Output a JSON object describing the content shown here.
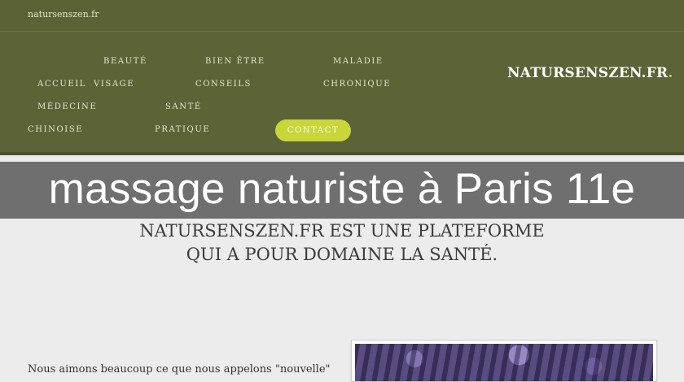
{
  "topbar": {
    "site_name": "natursenszen.fr"
  },
  "nav": {
    "accueil": "ACCUEIL",
    "beaute": "BEAUTÉ",
    "visage": "VISAGE",
    "bien_etre": "BIEN ÊTRE",
    "conseils": "CONSEILS",
    "maladie": "MALADIE",
    "chronique": "CHRONIQUE",
    "medecine": "MÉDECINE",
    "chinoise": "CHINOISE",
    "sante": "SANTÉ",
    "pratique": "PRATIQUE",
    "contact": "CONTACT"
  },
  "brand": {
    "name": "NATURSENSZEN.FR",
    "dot": "."
  },
  "page_title": "massage naturiste à Paris 11e",
  "tagline": "NATURSENSZEN.FR EST UNE PLATEFORME QUI A POUR DOMAINE LA SANTÉ.",
  "excerpt": "Nous aimons beaucoup ce que nous appelons \"nouvelle\"",
  "colors": {
    "header_green": "#5b6337",
    "accent": "#c8d63a",
    "title_band": "#6f6f6f"
  }
}
